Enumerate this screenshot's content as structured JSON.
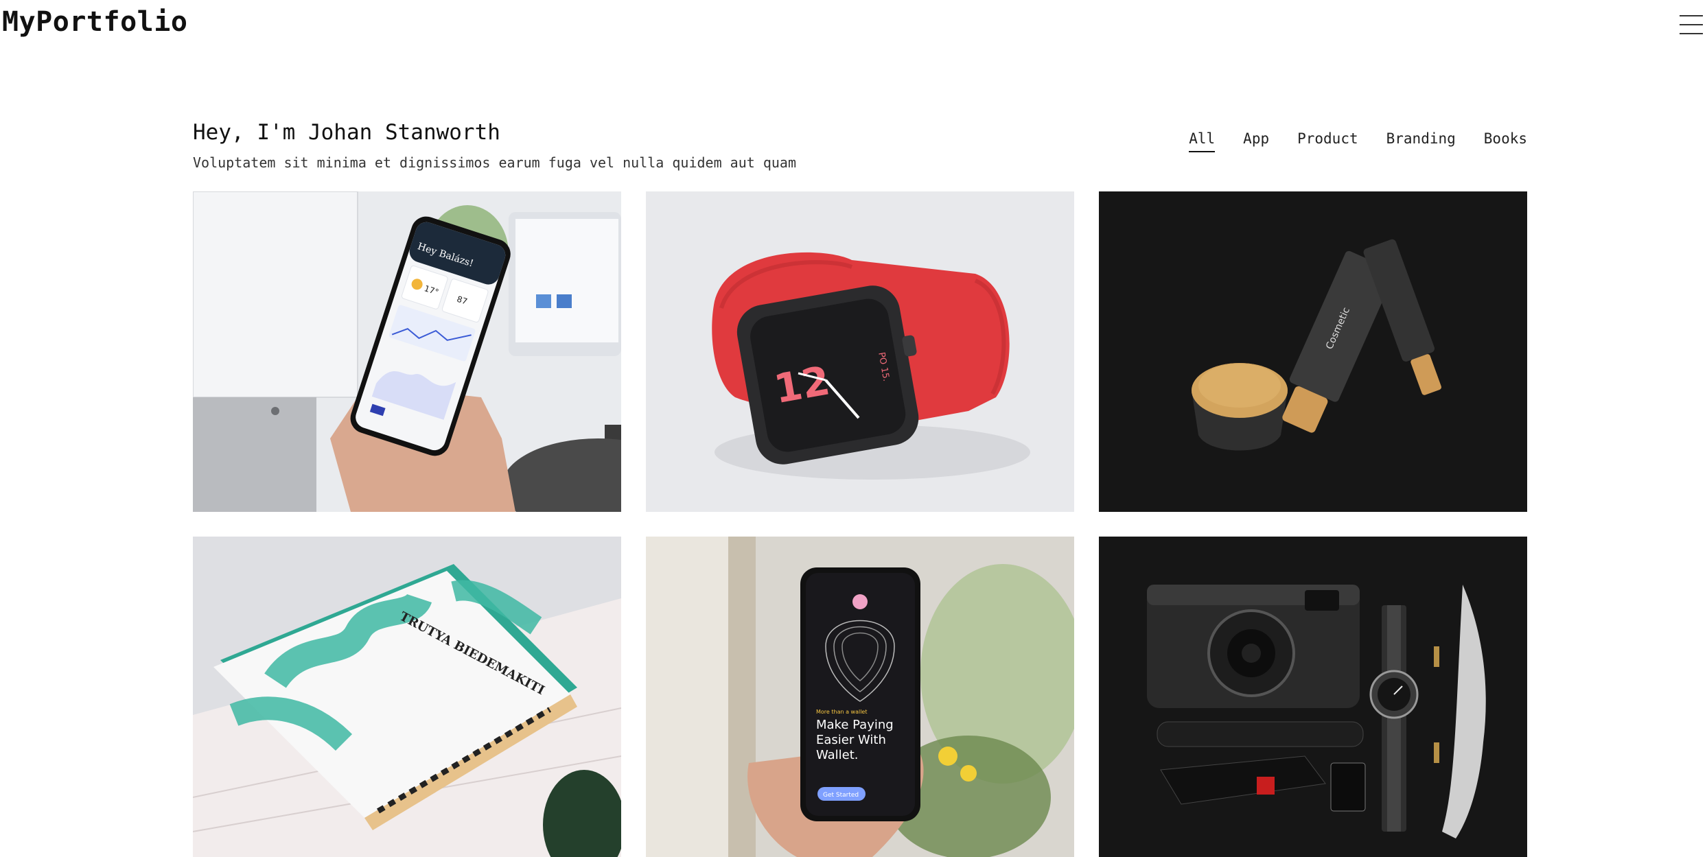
{
  "header": {
    "brand": "MyPortfolio",
    "menu_icon": "hamburger-menu-icon"
  },
  "intro": {
    "title": "Hey, I'm Johan Stanworth",
    "subtitle": "Voluptatem sit minima et dignissimos earum fuga vel nulla quidem aut quam"
  },
  "filters": {
    "items": [
      {
        "label": "All",
        "active": true
      },
      {
        "label": "App",
        "active": false
      },
      {
        "label": "Product",
        "active": false
      },
      {
        "label": "Branding",
        "active": false
      },
      {
        "label": "Books",
        "active": false
      }
    ]
  },
  "portfolio": {
    "items": [
      {
        "subject": "phone-app-photo",
        "screen_text": "Hey Balázs!",
        "temp": "17°",
        "aqi": "87"
      },
      {
        "subject": "red-smartwatch-photo",
        "watch_hour": "12",
        "watch_date": "PO 15."
      },
      {
        "subject": "cosmetic-products-photo",
        "label": "Cosmetic"
      },
      {
        "subject": "book-cover-photo",
        "title": "TRUTYA BIEDEMAKITI"
      },
      {
        "subject": "wallet-app-photo",
        "tag": "More than a wallet",
        "headline": "Make Paying Easier With Wallet.",
        "cta": "Get Started"
      },
      {
        "subject": "camera-flatlay-photo"
      }
    ]
  },
  "colors": {
    "text": "#111111",
    "background": "#ffffff",
    "watch_band": "#e03a3e",
    "book_accent": "#3fb8a3",
    "dark_tile": "#161616"
  }
}
